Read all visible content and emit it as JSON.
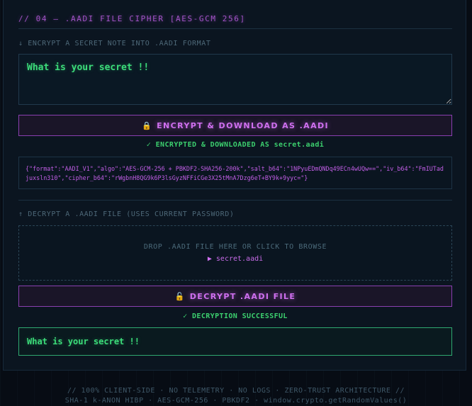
{
  "section": {
    "title": "// 04 — .AADI FILE CIPHER [AES-GCM 256]"
  },
  "encrypt": {
    "label": "↓ ENCRYPT A SECRET NOTE INTO .AADI FORMAT",
    "note_value": "What is your secret !!",
    "button_icon": "lock-icon",
    "button_label": "ENCRYPT & DOWNLOAD AS .AADI",
    "status": "✓ ENCRYPTED & DOWNLOADED AS secret.aadi",
    "json_output": "{\"format\":\"AADI_V1\",\"algo\":\"AES-GCM-256 + PBKDF2-SHA256-200k\",\"salt_b64\":\"1NPyuEDmQNDq49ECn4wUQw==\",\"iv_b64\":\"FmIUTadjuxsln310\",\"cipher_b64\":\"rWgbnH8QG9k6P3lsGyzNFFiCGe3X25tMnA7Dzg6eT+BY9k+9yyc=\"}"
  },
  "decrypt": {
    "label": "↑ DECRYPT A .AADI FILE (USES CURRENT PASSWORD)",
    "drop_text": "DROP .AADI FILE HERE OR CLICK TO BROWSE",
    "file_arrow": "▶",
    "file_name": "secret.aadi",
    "button_icon": "unlock-icon",
    "button_label": "DECRYPT .AADI FILE",
    "status": "✓ DECRYPTION SUCCESSFUL",
    "result": "What is your secret !!"
  },
  "footer": {
    "line1": "// 100% CLIENT-SIDE · NO TELEMETRY · NO LOGS · ZERO-TRUST ARCHITECTURE //",
    "line2": "SHA-1 k-ANON HIBP · AES-GCM-256 · PBKDF2 · window.crypto.getRandomValues()"
  },
  "colors": {
    "background": "#070c14",
    "panel": "#0b1520",
    "accent_purple": "#d070f0",
    "success_green": "#3cdc7a"
  }
}
